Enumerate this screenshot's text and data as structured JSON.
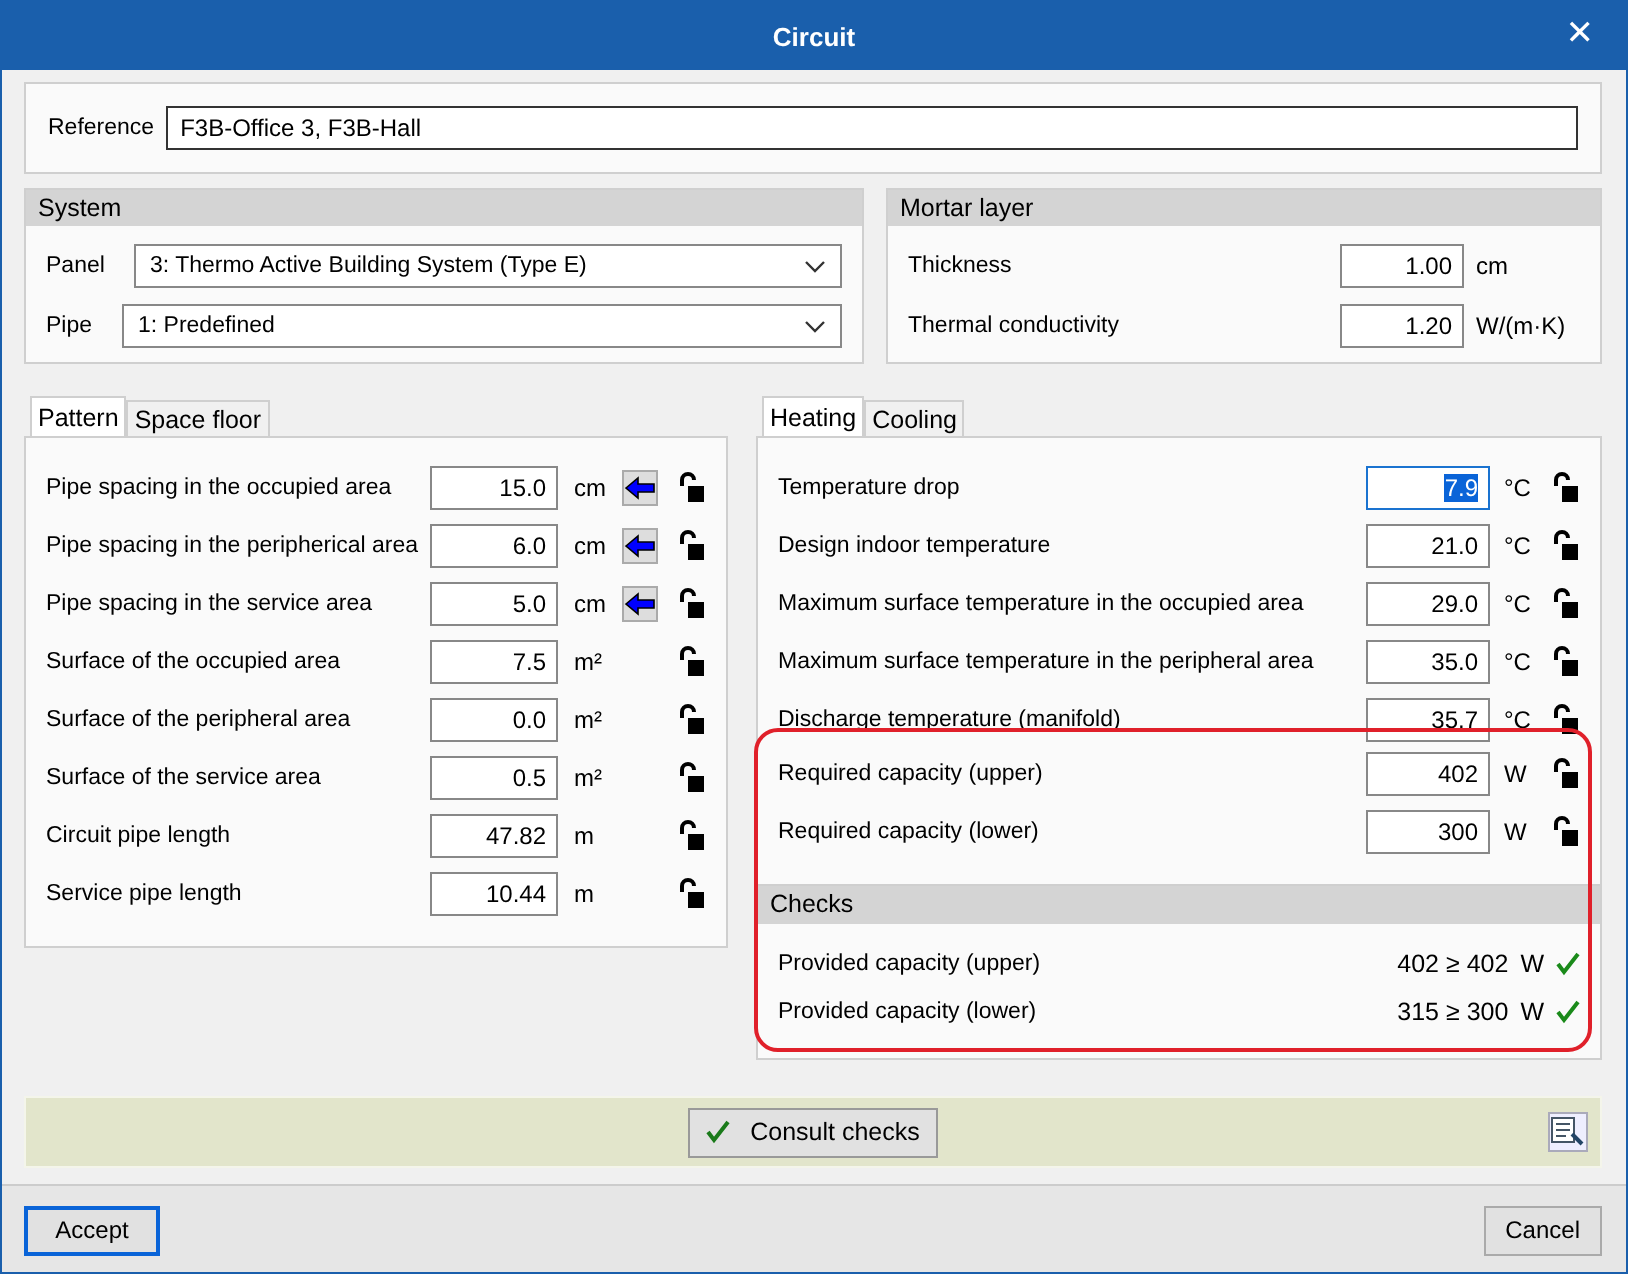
{
  "window": {
    "title": "Circuit",
    "close": "✕"
  },
  "reference": {
    "label": "Reference",
    "value": "F3B-Office 3, F3B-Hall"
  },
  "system": {
    "title": "System",
    "fields": [
      {
        "label": "Panel",
        "value": "3: Thermo Active Building System (Type E)"
      },
      {
        "label": "Pipe",
        "value": "1: Predefined"
      }
    ]
  },
  "mortar_layer": {
    "title": "Mortar layer",
    "fields": [
      {
        "label": "Thickness",
        "value": "1.00",
        "unit": "cm"
      },
      {
        "label": "Thermal conductivity",
        "value": "1.20",
        "unit": "W/(m·K)"
      }
    ]
  },
  "left_tabs": [
    {
      "label": "Pattern",
      "selected": true
    },
    {
      "label": "Space floor",
      "selected": false
    }
  ],
  "pattern_rows": [
    {
      "label": "Pipe spacing in the occupied area",
      "value": "15.0",
      "unit": "cm",
      "arrow": true
    },
    {
      "label": "Pipe spacing in the peripherical area",
      "value": "6.0",
      "unit": "cm",
      "arrow": true
    },
    {
      "label": "Pipe spacing in the service area",
      "value": "5.0",
      "unit": "cm",
      "arrow": true
    },
    {
      "label": "Surface of the occupied area",
      "value": "7.5",
      "unit": "m²",
      "arrow": false
    },
    {
      "label": "Surface of the peripheral area",
      "value": "0.0",
      "unit": "m²",
      "arrow": false
    },
    {
      "label": "Surface of the service area",
      "value": "0.5",
      "unit": "m²",
      "arrow": false
    },
    {
      "label": "Circuit pipe length",
      "value": "47.82",
      "unit": "m",
      "arrow": false
    },
    {
      "label": "Service pipe length",
      "value": "10.44",
      "unit": "m",
      "arrow": false
    }
  ],
  "right_tabs": [
    {
      "label": "Heating",
      "selected": true
    },
    {
      "label": "Cooling",
      "selected": false
    }
  ],
  "heating_rows": [
    {
      "label": "Temperature drop",
      "value": "7.9",
      "unit": "°C",
      "focused": true
    },
    {
      "label": "Design indoor temperature",
      "value": "21.0",
      "unit": "°C",
      "focused": false
    },
    {
      "label": "Maximum surface temperature in the occupied area",
      "value": "29.0",
      "unit": "°C",
      "focused": false
    },
    {
      "label": "Maximum surface temperature in the peripheral area",
      "value": "35.0",
      "unit": "°C",
      "focused": false
    },
    {
      "label": "Discharge temperature (manifold)",
      "value": "35.7",
      "unit": "°C",
      "focused": false
    }
  ],
  "required_rows": [
    {
      "label": "Required capacity (upper)",
      "value": "402",
      "unit": "W"
    },
    {
      "label": "Required capacity (lower)",
      "value": "300",
      "unit": "W"
    }
  ],
  "checks": {
    "title": "Checks",
    "rows": [
      {
        "label": "Provided capacity (upper)",
        "value": "402 ≥ 402",
        "unit": "W",
        "passed": true
      },
      {
        "label": "Provided capacity (lower)",
        "value": "315 ≥ 300",
        "unit": "W",
        "passed": true
      }
    ]
  },
  "consult_button": "Consult checks",
  "buttons": {
    "accept": "Accept",
    "cancel": "Cancel"
  }
}
